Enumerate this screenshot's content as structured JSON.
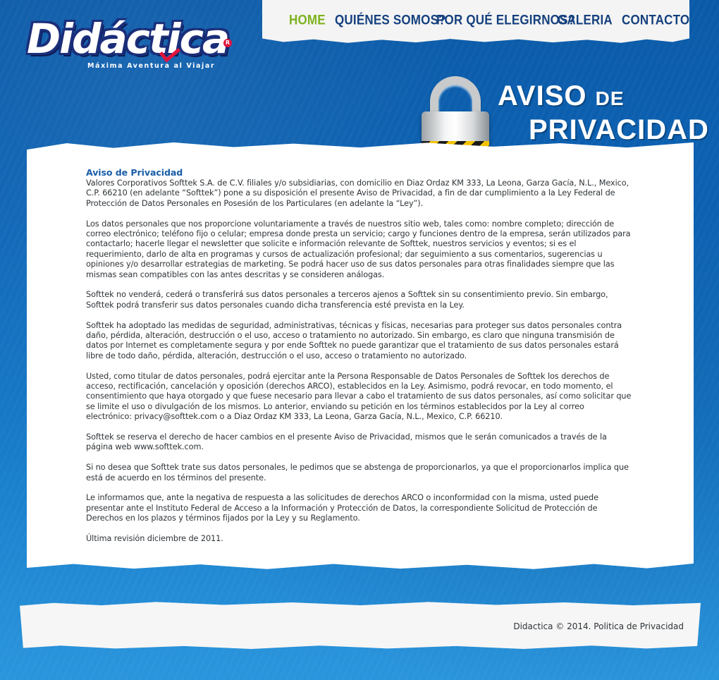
{
  "nav": {
    "items": [
      {
        "label": "HOME",
        "active": true
      },
      {
        "label": "QUIÉNES SOMOS?",
        "active": false
      },
      {
        "label": "POR QUÉ ELEGIRNOS?",
        "active": false
      },
      {
        "label": "GALERIA",
        "active": false
      },
      {
        "label": "CONTACTO",
        "active": false
      }
    ],
    "active_color": "#7cb21d",
    "color": "#15407e"
  },
  "logo": {
    "wordmark": "Didáctica",
    "registered": "R",
    "tagline": "Máxima Aventura al Viajar"
  },
  "banner": {
    "line1_big": "Aviso",
    "line1_small": "de",
    "line2": "Privacidad",
    "icon": "padlock-icon"
  },
  "article": {
    "title": "Aviso de Privacidad",
    "title_color": "#1a5ea8",
    "paragraphs": [
      "Valores Corporativos Softtek S.A. de C.V. filiales y/o subsidiarias, con domicilio en Diaz Ordaz KM 333, La Leona, Garza Gacía, N.L., Mexico, C.P. 66210 (en adelante “Softtek”) pone a su disposición el presente Aviso de Privacidad, a fin de dar cumplimiento a la Ley Federal de Protección de Datos Personales en Posesión de los Particulares (en adelante la “Ley”).",
      "Los datos personales que nos proporcione voluntariamente a través de nuestros sitio web, tales como: nombre completo; dirección de correo electrónico; teléfono fijo o celular; empresa donde presta un servicio; cargo y funciones dentro de la empresa, serán utilizados para contactarlo; hacerle llegar el newsletter que solicite e información relevante de Softtek, nuestros servicios y eventos; si es el requerimiento, darlo de alta en programas y cursos de actualización profesional; dar seguimiento a sus comentarios, sugerencias u opiniones y/o desarrollar estrategias de marketing. Se podrá hacer uso de sus datos personales para otras finalidades siempre que las mismas sean compatibles con las antes descritas y se consideren análogas.",
      "Softtek no venderá, cederá o transferirá sus datos personales a terceros ajenos a Softtek sin su consentimiento previo. Sin embargo, Softtek podrá transferir sus datos personales cuando dicha transferencia esté prevista en la Ley.",
      "Softtek ha adoptado las medidas de seguridad, administrativas, técnicas y físicas, necesarias para proteger sus datos personales contra daño, pérdida, alteración, destrucción o el uso, acceso o tratamiento no autorizado. Sin embargo, es claro que ninguna transmisión de datos por Internet es completamente segura y por ende Softtek no puede garantizar que el tratamiento de sus datos personales estará libre de todo daño, pérdida, alteración, destrucción o el uso, acceso o tratamiento no autorizado.",
      "Usted, como titular de datos personales, podrá ejercitar ante la Persona Responsable de Datos Personales de Softtek los derechos de acceso, rectificación, cancelación y oposición (derechos ARCO), establecidos en la Ley. Asimismo, podrá revocar, en todo momento, el consentimiento que haya otorgado y que fuese necesario para llevar a cabo el tratamiento de sus datos personales, así como solicitar que se limite el uso o divulgación de los mismos. Lo anterior, enviando su petición en los términos establecidos por la Ley al correo electrónico: privacy@softtek.com o a Diaz Ordaz KM 333, La Leona, Garza Gacía, N.L., Mexico, C.P. 66210.",
      "Softtek se reserva el derecho de hacer cambios en el presente Aviso de Privacidad, mismos que le serán comunicados a través de la página web www.softtek.com.",
      "Si no desea que Softtek trate sus datos personales, le pedimos que se abstenga de proporcionarlos, ya que el proporcionarlos implica que está de acuerdo en los términos del presente.",
      "Le informamos que, ante la negativa de respuesta a las solicitudes de derechos ARCO o inconformidad con la misma, usted puede presentar ante el Instituto Federal de Acceso a la Información y Protección de Datos, la correspondiente Solicitud de Protección de Derechos en los plazos y términos fijados por la Ley y su Reglamento.",
      "Última revisión diciembre de 2011."
    ]
  },
  "footer": {
    "text": "Didactica © 2014. Politica de Privacidad"
  }
}
